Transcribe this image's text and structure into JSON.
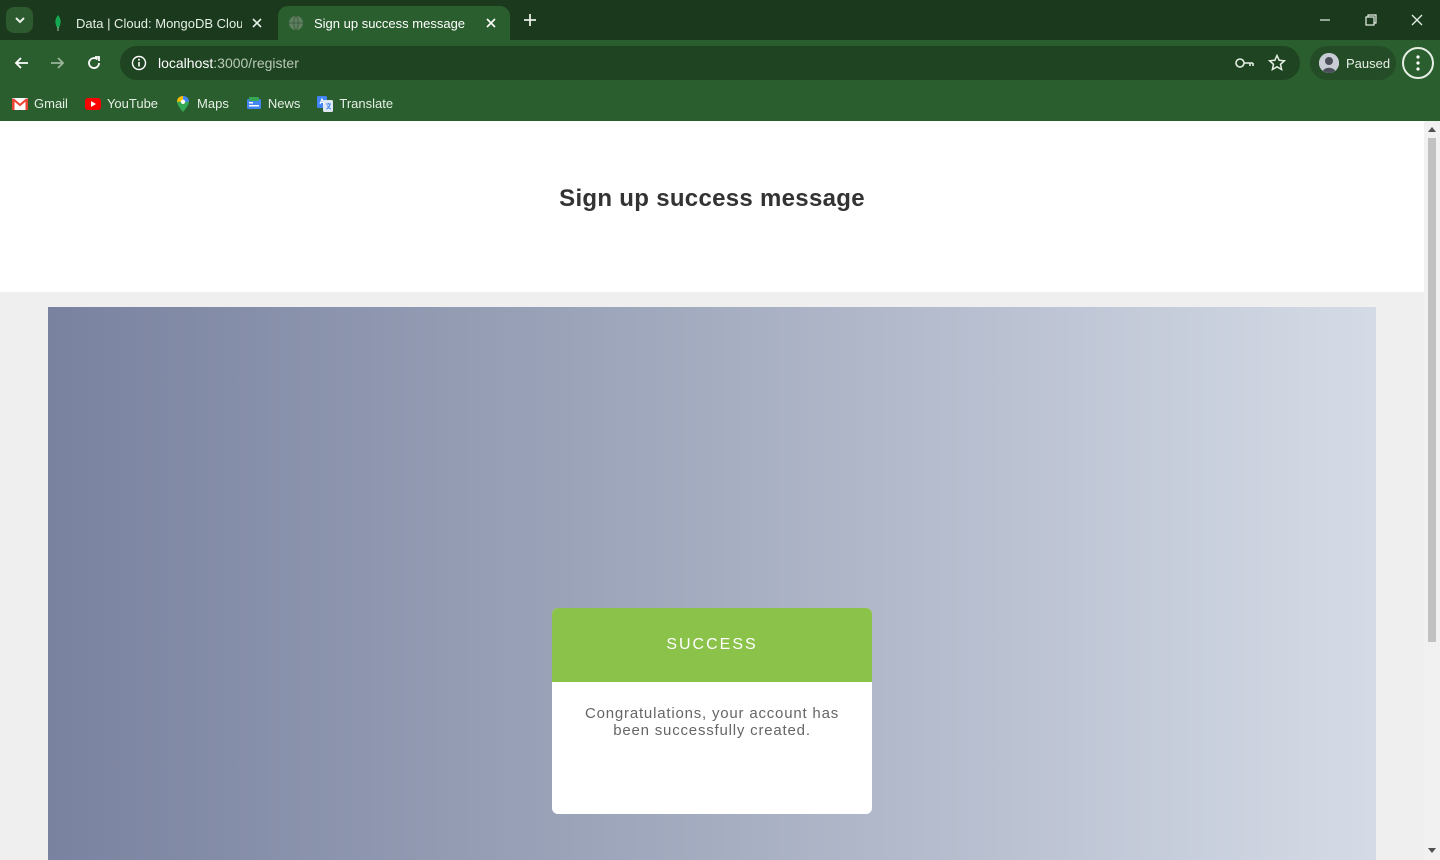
{
  "browser": {
    "tabs": [
      {
        "title": "Data | Cloud: MongoDB Cloud",
        "active": false,
        "favicon": "mongodb-leaf-icon"
      },
      {
        "title": "Sign up success message",
        "active": true,
        "favicon": "globe-icon"
      }
    ],
    "address": {
      "host": "localhost",
      "path": ":3000/register"
    },
    "profile_status": "Paused",
    "bookmarks": [
      {
        "label": "Gmail",
        "icon": "gmail-icon"
      },
      {
        "label": "YouTube",
        "icon": "youtube-icon"
      },
      {
        "label": "Maps",
        "icon": "maps-icon"
      },
      {
        "label": "News",
        "icon": "news-icon"
      },
      {
        "label": "Translate",
        "icon": "translate-icon"
      }
    ],
    "theme_color": "#2b5e2e"
  },
  "page": {
    "title": "Sign up success message",
    "card": {
      "status": "SUCCESS",
      "message": "Congratulations, your account has been successfully created.",
      "accent_color": "#8bc34a"
    }
  }
}
